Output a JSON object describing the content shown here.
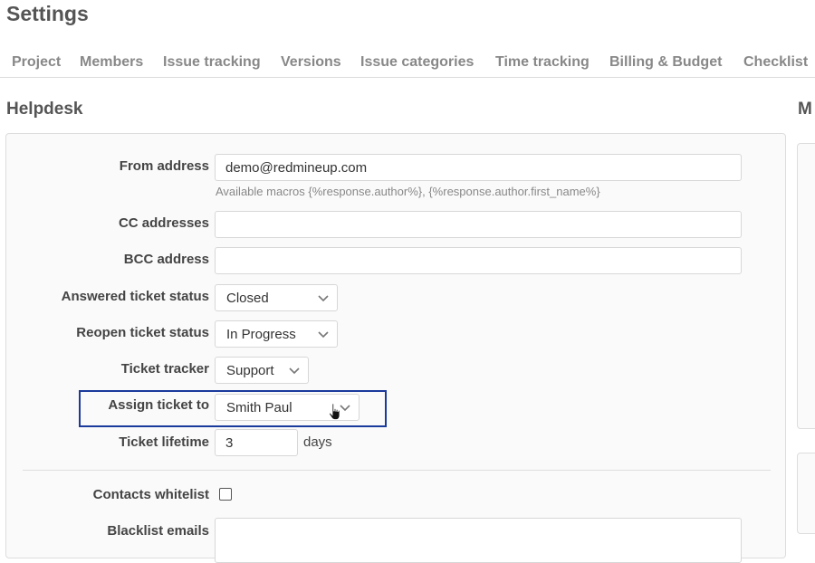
{
  "page": {
    "title": "Settings"
  },
  "tabs": [
    {
      "label": "Project"
    },
    {
      "label": "Members"
    },
    {
      "label": "Issue tracking"
    },
    {
      "label": "Versions"
    },
    {
      "label": "Issue categories"
    },
    {
      "label": "Time tracking"
    },
    {
      "label": "Billing & Budget"
    },
    {
      "label": "Checklist"
    }
  ],
  "helpdesk": {
    "title": "Helpdesk",
    "right_title": "M",
    "from_address": {
      "label": "From address",
      "value": "demo@redmineup.com",
      "hint": "Available macros {%response.author%}, {%response.author.first_name%}"
    },
    "cc_addresses": {
      "label": "CC addresses",
      "value": ""
    },
    "bcc_address": {
      "label": "BCC address",
      "value": ""
    },
    "answered_status": {
      "label": "Answered ticket status",
      "value": "Closed"
    },
    "reopen_status": {
      "label": "Reopen ticket status",
      "value": "In Progress"
    },
    "ticket_tracker": {
      "label": "Ticket tracker",
      "value": "Support"
    },
    "assign_ticket": {
      "label": "Assign ticket to",
      "value": "Smith Paul"
    },
    "ticket_lifetime": {
      "label": "Ticket lifetime",
      "value": "3",
      "unit": "days"
    },
    "contacts_whitelist": {
      "label": "Contacts whitelist",
      "checked": false
    },
    "blacklist_emails": {
      "label": "Blacklist emails",
      "value": ""
    }
  },
  "colors": {
    "highlight_border": "#1a3a9c",
    "tab_text": "#888888",
    "label_text": "#444444"
  },
  "icons": {
    "dropdown": "chevron-down-icon",
    "cursor": "hand-pointer-icon"
  }
}
